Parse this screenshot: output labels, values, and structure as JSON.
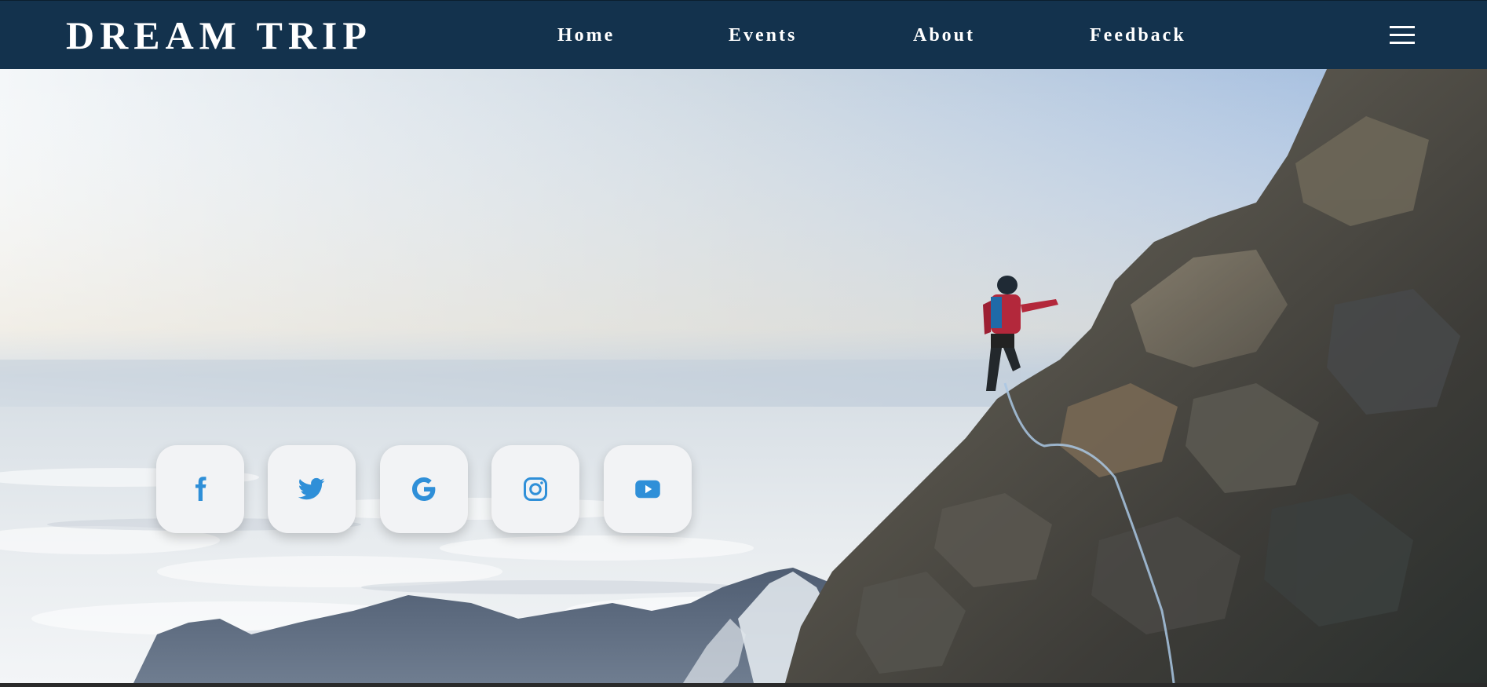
{
  "navbar": {
    "brand": "DREAM TRIP",
    "links": [
      {
        "label": "Home"
      },
      {
        "label": "Events"
      },
      {
        "label": "About"
      },
      {
        "label": "Feedback"
      }
    ],
    "menu_icon": "hamburger-menu-icon"
  },
  "hero": {
    "image_description_icon": "mountain-climber-hero-image"
  },
  "social": [
    {
      "icon": "facebook-icon"
    },
    {
      "icon": "twitter-icon"
    },
    {
      "icon": "google-icon"
    },
    {
      "icon": "instagram-icon"
    },
    {
      "icon": "youtube-icon"
    }
  ],
  "colors": {
    "navbar_bg": "#13324d",
    "nav_text": "#ffffff",
    "icon_accent": "#2f8fd8",
    "social_tile_bg": "#f2f3f5"
  }
}
